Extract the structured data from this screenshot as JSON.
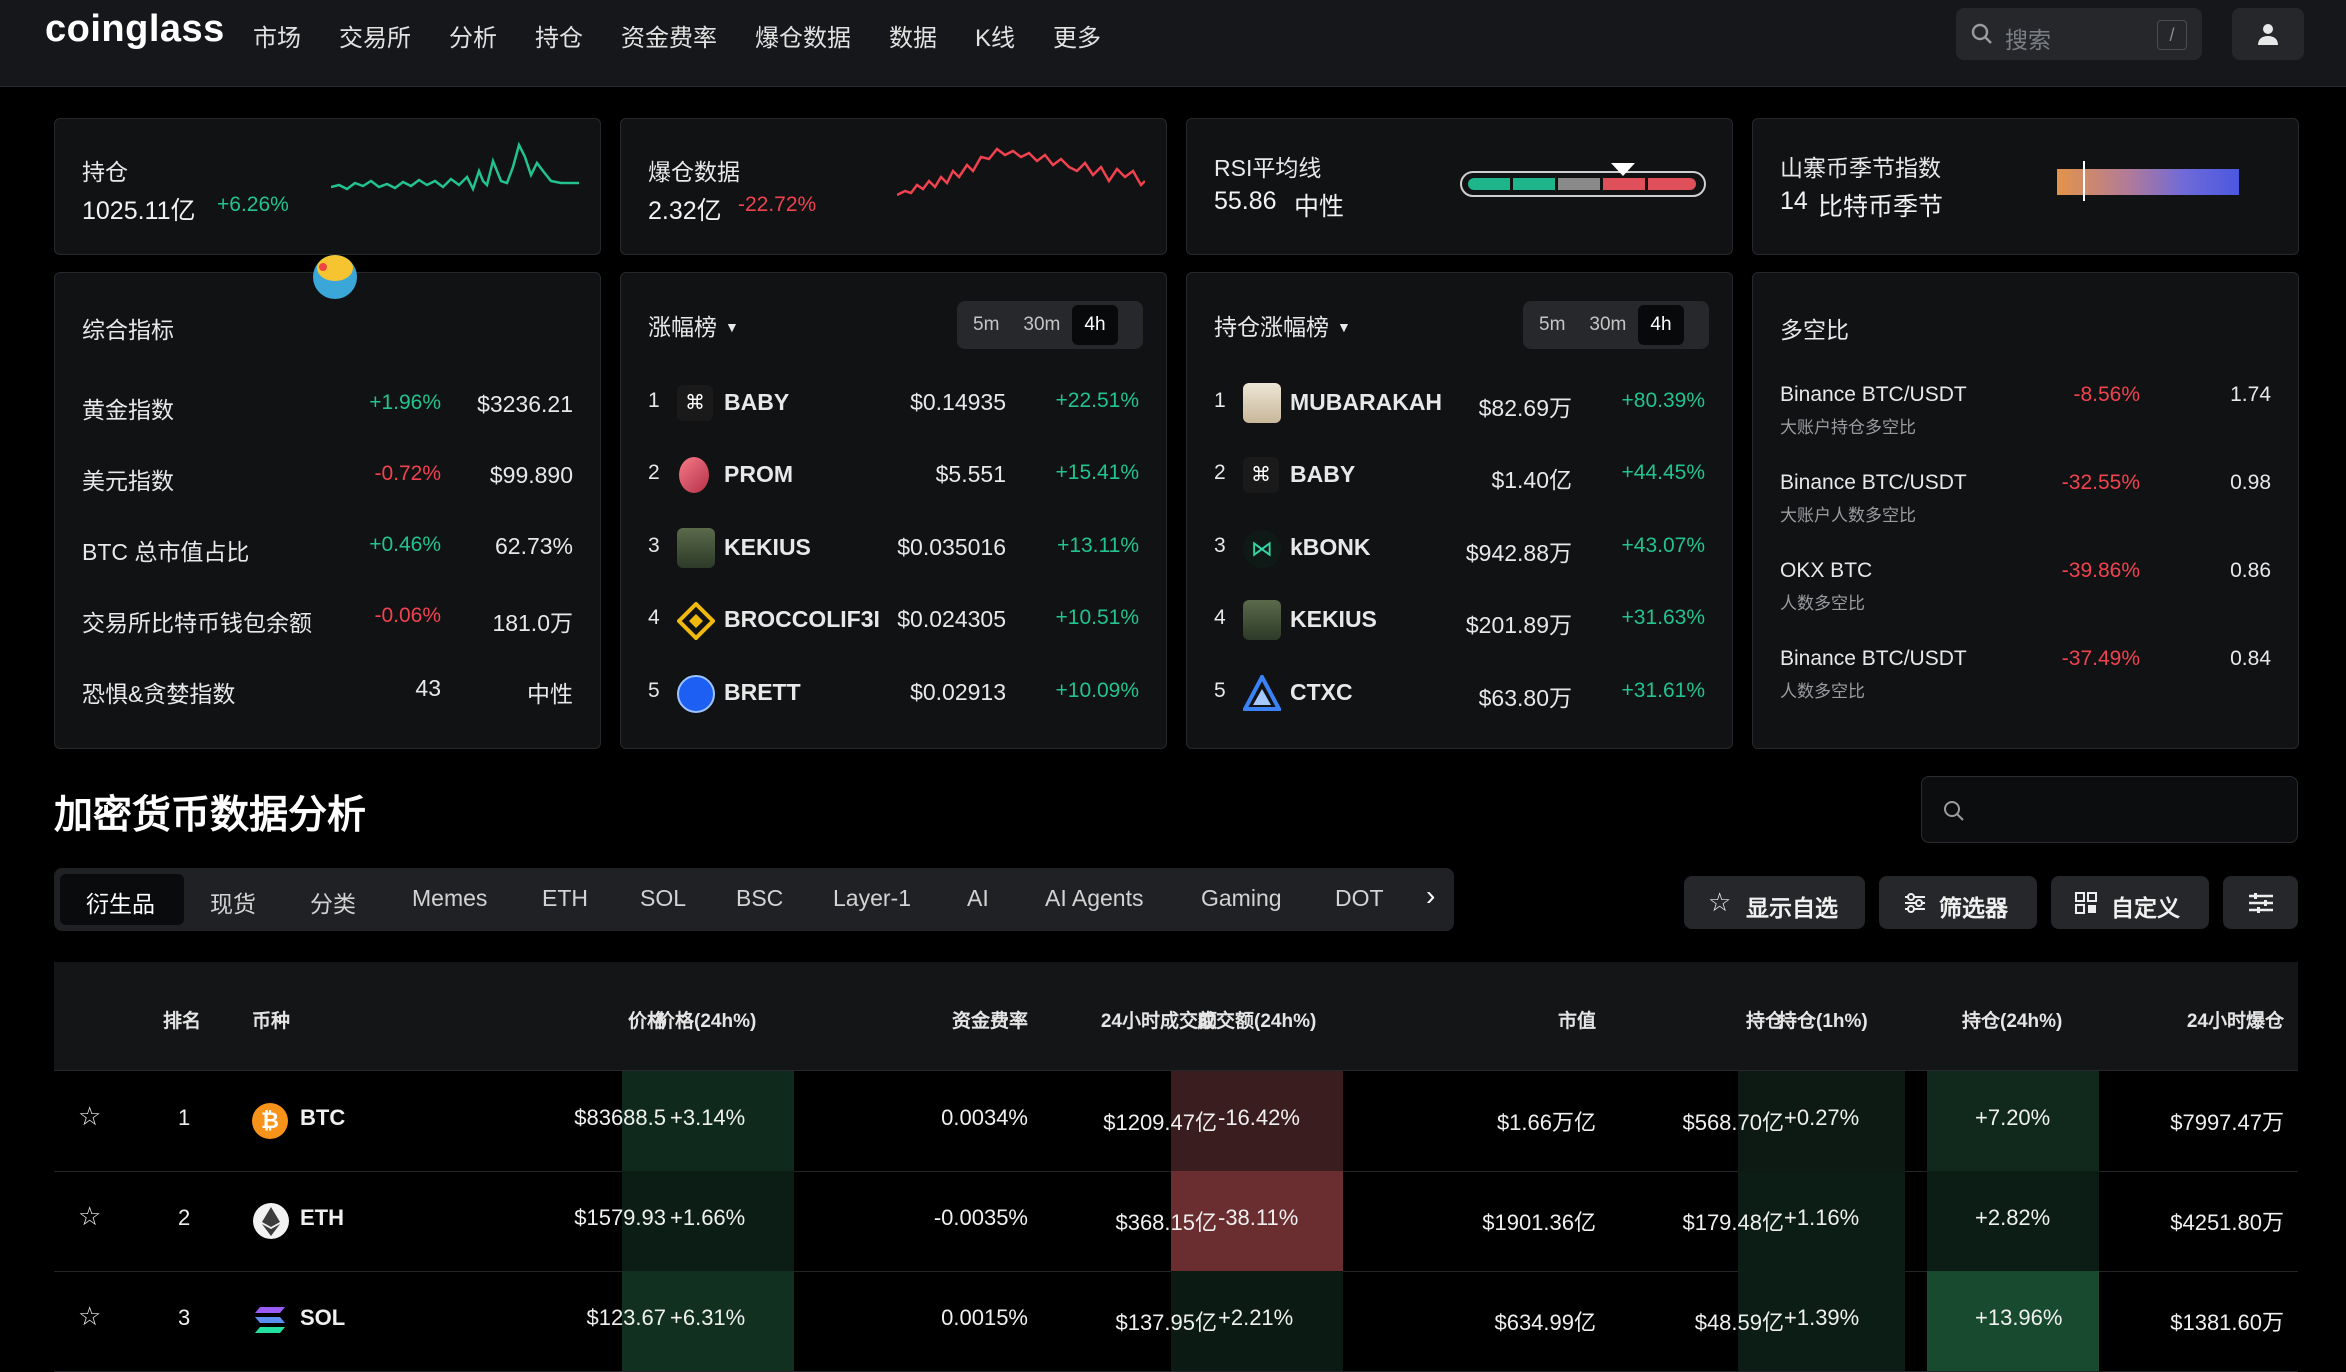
{
  "nav": {
    "logo": "coinglass",
    "menu": [
      "市场",
      "交易所",
      "分析",
      "持仓",
      "资金费率",
      "爆仓数据",
      "数据",
      "K线",
      "更多"
    ],
    "search_placeholder": "搜索",
    "search_shortcut": "/"
  },
  "cards_top": {
    "oi": {
      "title": "持仓",
      "value": "1025.11亿",
      "change": "+6.26%"
    },
    "liq": {
      "title": "爆仓数据",
      "value": "2.32亿",
      "change": "-22.72%"
    },
    "rsi": {
      "title": "RSI平均线",
      "value": "55.86",
      "label": "中性"
    },
    "altseason": {
      "title": "山寨币季节指数",
      "value": "14",
      "label": "比特币季节"
    }
  },
  "composite": {
    "title": "综合指标",
    "rows": [
      {
        "name": "黄金指数",
        "change": "+1.96%",
        "value": "$3236.21"
      },
      {
        "name": "美元指数",
        "change": "-0.72%",
        "value": "$99.890"
      },
      {
        "name": "BTC 总市值占比",
        "change": "+0.46%",
        "value": "62.73%"
      },
      {
        "name": "交易所比特币钱包余额",
        "change": "-0.06%",
        "value": "181.0万"
      },
      {
        "name": "恐惧&贪婪指数",
        "change": "43",
        "value": "中性"
      }
    ]
  },
  "gainers": {
    "title": "涨幅榜",
    "periods": [
      "5m",
      "30m",
      "4h"
    ],
    "rows": [
      {
        "rank": "1",
        "name": "BABY",
        "price": "$0.14935",
        "change": "+22.51%"
      },
      {
        "rank": "2",
        "name": "PROM",
        "price": "$5.551",
        "change": "+15.41%"
      },
      {
        "rank": "3",
        "name": "KEKIUS",
        "price": "$0.035016",
        "change": "+13.11%"
      },
      {
        "rank": "4",
        "name": "BROCCOLIF3I",
        "price": "$0.024305",
        "change": "+10.51%"
      },
      {
        "rank": "5",
        "name": "BRETT",
        "price": "$0.02913",
        "change": "+10.09%"
      }
    ]
  },
  "oi_gainers": {
    "title": "持仓涨幅榜",
    "periods": [
      "5m",
      "30m",
      "4h"
    ],
    "rows": [
      {
        "rank": "1",
        "name": "MUBARAKAH",
        "price": "$82.69万",
        "change": "+80.39%"
      },
      {
        "rank": "2",
        "name": "BABY",
        "price": "$1.40亿",
        "change": "+44.45%"
      },
      {
        "rank": "3",
        "name": "kBONK",
        "price": "$942.88万",
        "change": "+43.07%"
      },
      {
        "rank": "4",
        "name": "KEKIUS",
        "price": "$201.89万",
        "change": "+31.63%"
      },
      {
        "rank": "5",
        "name": "CTXC",
        "price": "$63.80万",
        "change": "+31.61%"
      }
    ]
  },
  "longshort": {
    "title": "多空比",
    "rows": [
      {
        "name": "Binance BTC/USDT",
        "sub": "大账户持仓多空比",
        "change": "-8.56%",
        "value": "1.74"
      },
      {
        "name": "Binance BTC/USDT",
        "sub": "大账户人数多空比",
        "change": "-32.55%",
        "value": "0.98"
      },
      {
        "name": "OKX BTC",
        "sub": "人数多空比",
        "change": "-39.86%",
        "value": "0.86"
      },
      {
        "name": "Binance BTC/USDT",
        "sub": "人数多空比",
        "change": "-37.49%",
        "value": "0.84"
      }
    ]
  },
  "section": {
    "title": "加密货币数据分析",
    "tabs": [
      "衍生品",
      "现货",
      "分类",
      "Memes",
      "ETH",
      "SOL",
      "BSC",
      "Layer-1",
      "AI",
      "AI Agents",
      "Gaming",
      "DOT"
    ],
    "btn_watchlist": "显示自选",
    "btn_filter": "筛选器",
    "btn_custom": "自定义"
  },
  "table": {
    "headers": [
      "排名",
      "币种",
      "价格",
      "价格(24h%)",
      "资金费率",
      "24小时成交额",
      "成交额(24h%)",
      "市值",
      "持仓",
      "持仓(1h%)",
      "持仓(24h%)",
      "24小时爆仓"
    ],
    "rows": [
      {
        "rank": "1",
        "coin": "BTC",
        "price": "$83688.5",
        "chg24": "+3.14%",
        "funding": "0.0034%",
        "vol": "$1209.47亿",
        "volchg": "-16.42%",
        "mcap": "$1.66万亿",
        "oi": "$568.70亿",
        "oi1h": "+0.27%",
        "oi24": "+7.20%",
        "liq": "$7997.47万"
      },
      {
        "rank": "2",
        "coin": "ETH",
        "price": "$1579.93",
        "chg24": "+1.66%",
        "funding": "-0.0035%",
        "vol": "$368.15亿",
        "volchg": "-38.11%",
        "mcap": "$1901.36亿",
        "oi": "$179.48亿",
        "oi1h": "+1.16%",
        "oi24": "+2.82%",
        "liq": "$4251.80万"
      },
      {
        "rank": "3",
        "coin": "SOL",
        "price": "$123.67",
        "chg24": "+6.31%",
        "funding": "0.0015%",
        "vol": "$137.95亿",
        "volchg": "+2.21%",
        "mcap": "$634.99亿",
        "oi": "$48.59亿",
        "oi1h": "+1.39%",
        "oi24": "+13.96%",
        "liq": "$1381.60万"
      }
    ]
  },
  "colors": {
    "green": "#22c38e",
    "red": "#f1424f",
    "bg": "#000000",
    "card": "#111214"
  }
}
